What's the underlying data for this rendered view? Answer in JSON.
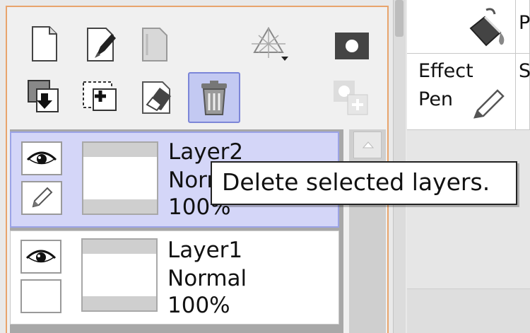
{
  "toolbar": {
    "buttons": [
      {
        "icon": "new-layer-icon"
      },
      {
        "icon": "new-vector-layer-icon"
      },
      {
        "icon": "new-folder-icon"
      },
      {
        "icon": "perspective-ruler-icon"
      },
      {
        "icon": "layer-mask-icon"
      },
      {
        "icon": "transfer-down-icon"
      },
      {
        "icon": "merge-down-icon"
      },
      {
        "icon": "clear-layer-icon"
      },
      {
        "icon": "delete-layer-icon"
      },
      {
        "icon": "apply-mask-icon"
      }
    ]
  },
  "layers": [
    {
      "name": "Layer2",
      "mode": "Normal",
      "opacity": "100%",
      "selected": true
    },
    {
      "name": "Layer1",
      "mode": "Normal",
      "opacity": "100%",
      "selected": false
    }
  ],
  "tooltip": {
    "text": "Delete selected layers."
  },
  "brush_panel": {
    "cells": [
      {
        "label_line1": "Effect",
        "label_line2": "Pen",
        "icon": "pen-icon"
      },
      {
        "label_line1": "S",
        "label_line2": ""
      },
      {
        "label_line1": "",
        "label_line2": "",
        "icon": "bucket-icon"
      },
      {
        "label_line1": "P",
        "label_line2": ""
      }
    ]
  },
  "colors": {
    "panel_border": "#e8a46c",
    "selected_layer_bg": "#d4d6f8",
    "delete_button_bg": "#c3c9f2"
  }
}
